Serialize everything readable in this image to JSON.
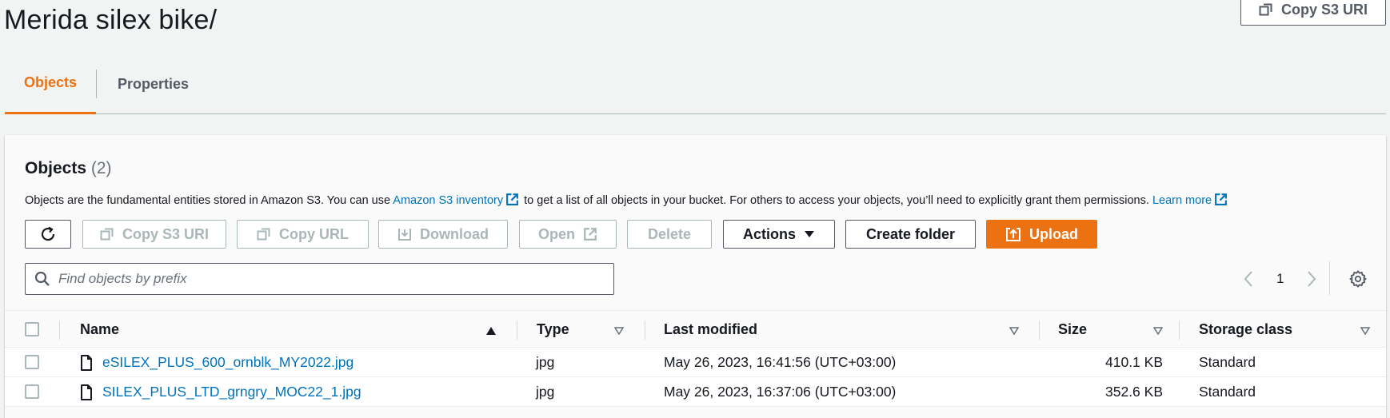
{
  "header": {
    "title": "Merida silex bike/",
    "copy_uri_label": "Copy S3 URI"
  },
  "tabs": [
    {
      "label": "Objects",
      "active": true
    },
    {
      "label": "Properties",
      "active": false
    }
  ],
  "objects_panel": {
    "title": "Objects",
    "count": "(2)",
    "description_pre": "Objects are the fundamental entities stored in Amazon S3. You can use",
    "inventory_link": "Amazon S3 inventory",
    "description_mid": "to get a list of all objects in your bucket. For others to access your objects, you’ll need to explicitly grant them permissions.",
    "learn_more": "Learn more"
  },
  "toolbar": {
    "copy_uri": "Copy S3 URI",
    "copy_url": "Copy URL",
    "download": "Download",
    "open": "Open",
    "delete": "Delete",
    "actions": "Actions",
    "create_folder": "Create folder",
    "upload": "Upload"
  },
  "search": {
    "placeholder": "Find objects by prefix",
    "value": ""
  },
  "pagination": {
    "current_page": "1"
  },
  "table": {
    "columns": [
      "Name",
      "Type",
      "Last modified",
      "Size",
      "Storage class"
    ],
    "rows": [
      {
        "name": "eSILEX_PLUS_600_ornblk_MY2022.jpg",
        "type": "jpg",
        "last_modified": "May 26, 2023, 16:41:56 (UTC+03:00)",
        "size": "410.1 KB",
        "storage_class": "Standard"
      },
      {
        "name": "SILEX_PLUS_LTD_grngry_MOC22_1.jpg",
        "type": "jpg",
        "last_modified": "May 26, 2023, 16:37:06 (UTC+03:00)",
        "size": "352.6 KB",
        "storage_class": "Standard"
      }
    ]
  },
  "colors": {
    "accent": "#ec7211",
    "link": "#0073bb",
    "text": "#16191f",
    "disabled": "#aab7b8"
  },
  "icons": [
    "copy-icon",
    "refresh-icon",
    "download-icon",
    "external-link-icon",
    "caret-down-icon",
    "upload-icon",
    "search-icon",
    "chevron-left-icon",
    "chevron-right-icon",
    "gear-icon",
    "sort-asc-icon",
    "sort-icon",
    "file-icon"
  ]
}
